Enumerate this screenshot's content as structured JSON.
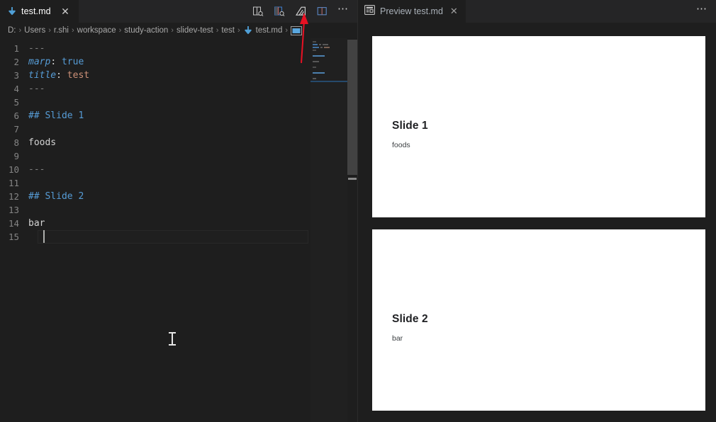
{
  "editor": {
    "tab": {
      "label": "test.md",
      "file_icon": "markdown-down-arrow-icon",
      "close_icon": "close-icon"
    },
    "actions": [
      {
        "name": "open-preview-icon",
        "label": "Open Preview"
      },
      {
        "name": "open-preview-to-side-icon",
        "label": "Open Preview to the Side"
      },
      {
        "name": "marp-icon",
        "label": "Marp: Toggle Marp feature"
      },
      {
        "name": "split-editor-right-icon",
        "label": "Split Editor Right"
      },
      {
        "name": "more-actions-icon",
        "label": "..."
      }
    ],
    "breadcrumb": [
      "D:",
      "Users",
      "r.shi",
      "workspace",
      "study-action",
      "slidev-test",
      "test",
      "test.md"
    ],
    "breadcrumb_separator": "›",
    "breadcrumb_file_icon": "markdown-down-arrow-icon",
    "breadcrumb_symbol_icon": "abc-symbol-icon",
    "lines": [
      {
        "n": "1",
        "tokens": [
          {
            "t": "---",
            "c": "tok-hr"
          }
        ]
      },
      {
        "n": "2",
        "tokens": [
          {
            "t": "marp",
            "c": "tok-key"
          },
          {
            "t": ":",
            "c": "tok-colon"
          },
          {
            "t": " true",
            "c": "tok-bool"
          }
        ]
      },
      {
        "n": "3",
        "tokens": [
          {
            "t": "title",
            "c": "tok-key"
          },
          {
            "t": ":",
            "c": "tok-colon"
          },
          {
            "t": " test",
            "c": "tok-str"
          }
        ]
      },
      {
        "n": "4",
        "tokens": [
          {
            "t": "---",
            "c": "tok-hr"
          }
        ]
      },
      {
        "n": "5",
        "tokens": []
      },
      {
        "n": "6",
        "tokens": [
          {
            "t": "## Slide 1",
            "c": "tok-head"
          }
        ]
      },
      {
        "n": "7",
        "tokens": []
      },
      {
        "n": "8",
        "tokens": [
          {
            "t": "foods",
            "c": "tok-text"
          }
        ]
      },
      {
        "n": "9",
        "tokens": []
      },
      {
        "n": "10",
        "tokens": [
          {
            "t": "---",
            "c": "tok-hr"
          }
        ]
      },
      {
        "n": "11",
        "tokens": []
      },
      {
        "n": "12",
        "tokens": [
          {
            "t": "## Slide 2",
            "c": "tok-head"
          }
        ]
      },
      {
        "n": "13",
        "tokens": []
      },
      {
        "n": "14",
        "tokens": [
          {
            "t": "bar",
            "c": "tok-text"
          }
        ]
      },
      {
        "n": "15",
        "tokens": []
      }
    ],
    "cursor_line": 15
  },
  "preview": {
    "tab": {
      "label": "Preview test.md",
      "icon": "preview-layout-icon",
      "close_icon": "close-icon"
    },
    "more_actions_icon": "more-actions-icon",
    "slides": [
      {
        "heading": "Slide 1",
        "body": "foods"
      },
      {
        "heading": "Slide 2",
        "body": "bar"
      }
    ]
  },
  "annotation": {
    "arrow_color": "#e81123",
    "points_at": "marp-icon"
  },
  "colors": {
    "editor_background": "#1e1e1e",
    "tabbar_background": "#252526",
    "keyword": "#569cd6",
    "string": "#ce9178",
    "line_number": "#858585",
    "slide_background": "#ffffff"
  }
}
